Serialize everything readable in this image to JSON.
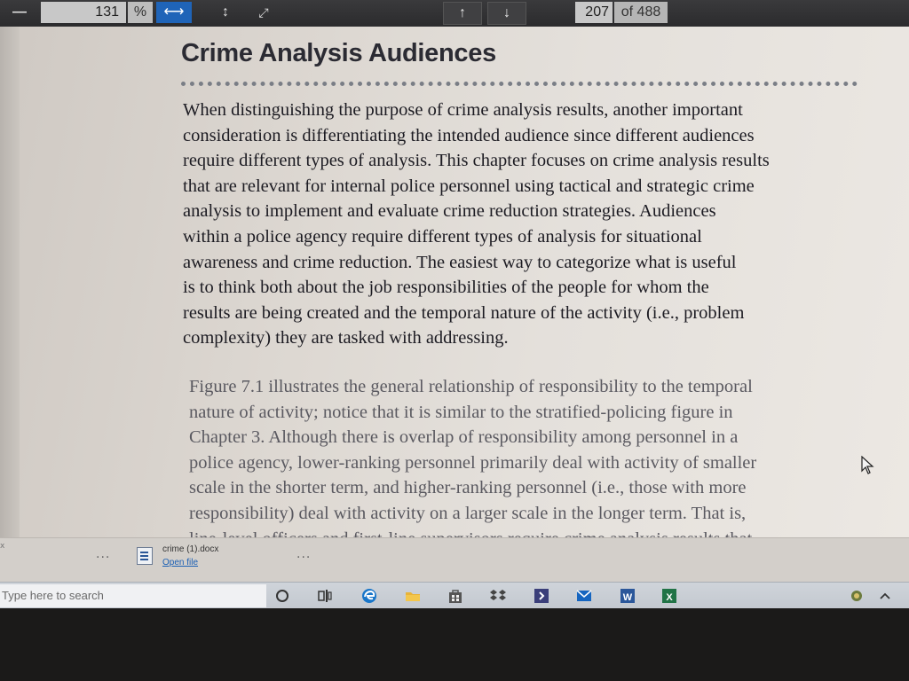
{
  "toolbar": {
    "zoom_out_symbol": "—",
    "zoom_value": "131",
    "zoom_unit": "%",
    "fit_width_symbol": "⟷",
    "fit_height_symbol": "↕",
    "fullscreen_symbol": "⤢",
    "page_up_symbol": "↑",
    "page_down_symbol": "↓",
    "page_number": "207",
    "page_total": "of 488"
  },
  "document": {
    "heading": "Crime Analysis Audiences",
    "paragraph_1": [
      "When distinguishing the purpose of crime analysis results, another important",
      "consideration is differentiating the intended audience since different audiences",
      "require different types of analysis. This chapter focuses on crime analysis results",
      "that are relevant for internal police personnel using tactical and strategic crime",
      "analysis to implement and evaluate crime reduction strategies. Audiences",
      "within a police agency require different types of analysis for situational",
      "awareness and crime reduction. The easiest way to categorize what is useful",
      "is to think both about the job responsibilities of the people for whom the",
      "results are being created and the temporal nature of the activity (i.e., problem",
      "complexity) they are tasked with addressing."
    ],
    "paragraph_2": [
      "Figure 7.1 illustrates the general relationship of responsibility to the temporal",
      "nature of activity; notice that it is similar to the stratified-policing figure in",
      "Chapter 3. Although there is overlap of responsibility among personnel in a",
      "police agency, lower-ranking personnel primarily deal with activity of smaller",
      "scale in the shorter term, and higher-ranking personnel (i.e., those with more",
      "responsibility) deal with activity on a larger scale in the longer term. That is,",
      "line-level officers and first-line supervisors require crime analysis results that"
    ]
  },
  "download_bar": {
    "left_menu": "...",
    "file_name": "crime (1).docx",
    "open_link": "Open file",
    "right_menu": "...",
    "left_edge_text": "x"
  },
  "taskbar": {
    "search_placeholder": "Type here to search"
  },
  "colors": {
    "accent": "#1f64b8",
    "page": "#e2ded9",
    "taskbar": "#c8cdd3"
  }
}
